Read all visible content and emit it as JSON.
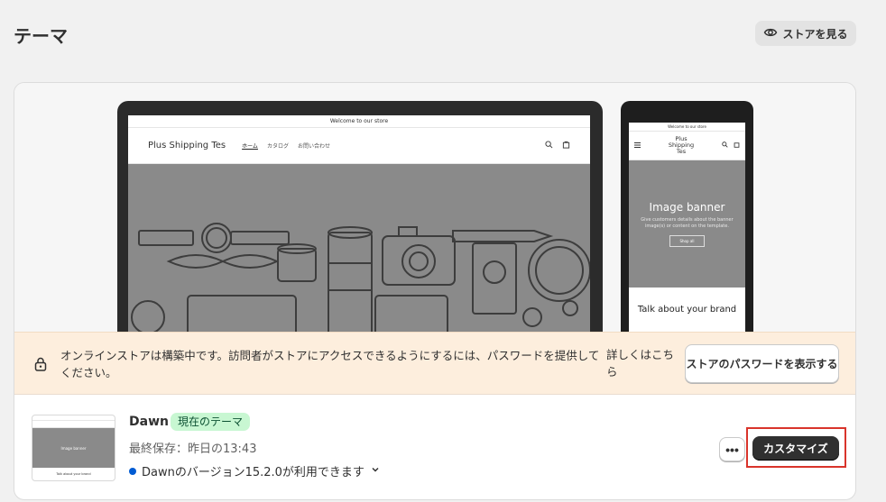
{
  "header": {
    "title": "テーマ",
    "view_store_label": "ストアを見る"
  },
  "preview": {
    "desktop": {
      "announcement": "Welcome to our store",
      "site_name": "Plus Shipping Tes",
      "nav": [
        "ホーム",
        "カタログ",
        "お問い合わせ"
      ]
    },
    "mobile": {
      "announcement": "Welcome to our store",
      "site_name": "Plus Shipping Tes",
      "hero_title": "Image banner",
      "hero_text": "Give customers details about the banner image(s) or content on the template.",
      "hero_button": "Shop all",
      "talk_title": "Talk about your brand"
    }
  },
  "banner": {
    "message": "オンラインストアは構築中です。訪問者がストアにアクセスできるようにするには、パスワードを提供してください。",
    "link_label": "詳しくはこちら",
    "button_label": "ストアのパスワードを表示する"
  },
  "theme": {
    "name": "Dawn",
    "badge": "現在のテーマ",
    "last_saved": "最終保存：昨日の13:43",
    "version_notice": "Dawnのバージョン15.2.0が利用できます",
    "thumb_hero": "Image banner",
    "thumb_talk": "Talk about your brand",
    "more_label": "•••",
    "customize_label": "カスタマイズ"
  },
  "colors": {
    "accent": "#303030",
    "badge_bg": "#c8f7d2",
    "banner_bg": "#fdeedd",
    "highlight": "#d9342b",
    "info_dot": "#005bd3"
  }
}
